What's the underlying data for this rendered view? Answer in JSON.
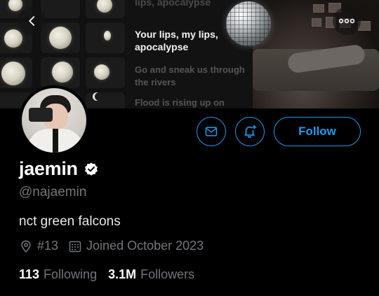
{
  "banner": {
    "lyrics": {
      "top_partial": "lips, apocalypse",
      "highlight": "Your lips, my lips, apocalypse",
      "next": "Go and sneak us through the rivers",
      "next2": "Flood is rising up on"
    }
  },
  "header": {
    "back_icon": "chevron-left-icon",
    "more_icon": "more-horizontal-icon"
  },
  "profile": {
    "display_name": "jaemin",
    "verified_icon": "verified-badge-icon",
    "handle": "@najaemin",
    "bio": "nct green falcons",
    "location": "#13",
    "joined": "Joined October 2023",
    "following_count": "113",
    "following_label": "Following",
    "followers_count": "3.1M",
    "followers_label": "Followers"
  },
  "actions": {
    "message_icon": "mail-icon",
    "notify_icon": "bell-plus-icon",
    "follow_label": "Follow"
  },
  "colors": {
    "accent": "#1d9bf0",
    "background": "#000000",
    "secondary_text": "#71767b",
    "primary_text": "#e7e9ea"
  }
}
